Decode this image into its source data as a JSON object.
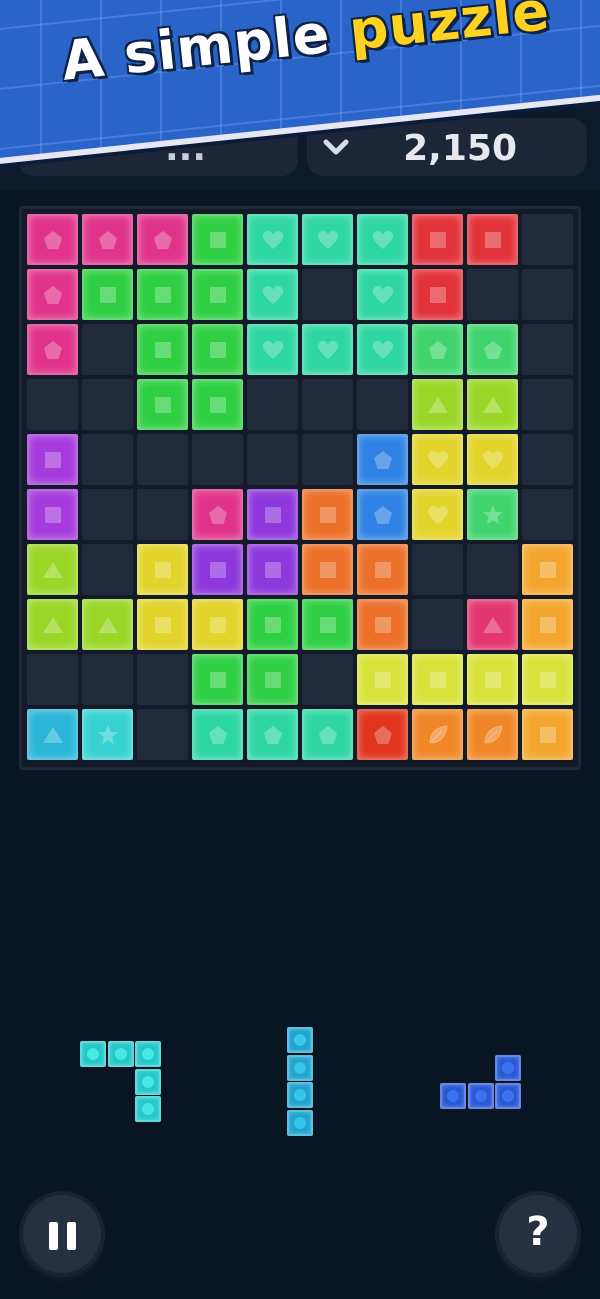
{
  "banner": {
    "title_plain": "A simple ",
    "title_highlight": "puzzle"
  },
  "scores": {
    "left_value": "...",
    "right_value": "2,150",
    "left_icon": "crown-icon",
    "right_icon": "chevron-down-icon"
  },
  "colors": {
    "M": "#e0348c",
    "G": "#2ecf43",
    "T": "#2dd6a2",
    "R": "#e2323a",
    "P": "#a53bdc",
    "V": "#8e37dc",
    "L": "#9ad628",
    "Y": "#e2d42b",
    "O": "#ec7029",
    "B": "#2d82e4",
    "N": "#e23670",
    "C": "#2ab6d6",
    "Q": "#37d1cf",
    "K": "#e2341d",
    "F": "#f08727",
    "H": "#3fd46d",
    "Z": "#d7e33a",
    "A": "#f3a62e"
  },
  "board": {
    "size": 10,
    "rows": [
      [
        "M:pentagon",
        "M:pentagon",
        "M:pentagon",
        "G:square",
        "T:heart",
        "T:heart",
        "T:heart",
        "R:square",
        "R:square",
        "."
      ],
      [
        "M:pentagon",
        "G:square",
        "G:square",
        "G:square",
        "T:heart",
        ".",
        "T:heart",
        "R:square",
        ".",
        "."
      ],
      [
        "M:pentagon",
        ".",
        "G:square",
        "G:square",
        "T:heart",
        "T:heart",
        "T:heart",
        "H:pentagon",
        "H:pentagon",
        "."
      ],
      [
        ".",
        ".",
        "G:square",
        "G:square",
        ".",
        ".",
        ".",
        "L:triangle",
        "L:triangle",
        "."
      ],
      [
        "P:square",
        ".",
        ".",
        ".",
        ".",
        ".",
        "B:pentagon",
        "Y:heart",
        "Y:heart",
        "."
      ],
      [
        "P:square",
        ".",
        ".",
        "M:pentagon",
        "V:square",
        "O:square",
        "B:pentagon",
        "Y:heart",
        "H:star",
        "."
      ],
      [
        "L:triangle",
        ".",
        "Y:square",
        "V:square",
        "V:square",
        "O:square",
        "O:square",
        ".",
        ".",
        "A:square"
      ],
      [
        "L:triangle",
        "L:triangle",
        "Y:square",
        "Y:square",
        "G:square",
        "G:square",
        "O:square",
        ".",
        "N:triangle",
        "A:square"
      ],
      [
        ".",
        ".",
        ".",
        "G:square",
        "G:square",
        ".",
        "Z:square",
        "Z:square",
        "Z:square",
        "Z:square"
      ],
      [
        "C:triangle",
        "Q:star",
        ".",
        "T:pentagon",
        "T:pentagon",
        "T:pentagon",
        "K:pentagon",
        "F:leaf",
        "F:leaf",
        "A:square"
      ]
    ]
  },
  "pieces": [
    {
      "name": "piece-l-shape",
      "color": "#22c7c7",
      "dot": "#47e8e3",
      "cells": [
        [
          0,
          0
        ],
        [
          1,
          0
        ],
        [
          2,
          0
        ],
        [
          2,
          1
        ],
        [
          2,
          2
        ]
      ]
    },
    {
      "name": "piece-vertical-line",
      "color": "#1fa3cf",
      "dot": "#36c6ea",
      "cells": [
        [
          0,
          0
        ],
        [
          0,
          1
        ],
        [
          0,
          2
        ],
        [
          0,
          3
        ]
      ]
    },
    {
      "name": "piece-j-shape",
      "color": "#2757d6",
      "dot": "#3a72f0",
      "cells": [
        [
          2,
          0
        ],
        [
          0,
          1
        ],
        [
          1,
          1
        ],
        [
          2,
          1
        ]
      ]
    }
  ],
  "controls": {
    "pause_icon": "pause-icon",
    "help_label": "?"
  }
}
